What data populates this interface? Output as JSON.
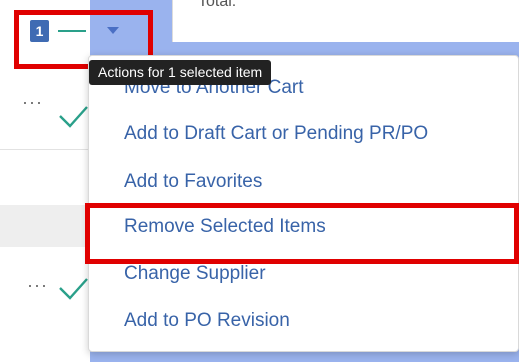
{
  "header": {
    "total_label": "Total:"
  },
  "selection": {
    "count": "1"
  },
  "tooltip": {
    "text": "Actions for 1 selected item"
  },
  "rows": [
    {
      "more": "···",
      "status_icon": "check-icon"
    },
    {
      "more": "···",
      "status_icon": "check-icon"
    }
  ],
  "menu": {
    "items": [
      {
        "label": "Move to Another Cart"
      },
      {
        "label": "Add to Draft Cart or Pending PR/PO"
      },
      {
        "label": "Add to Favorites"
      },
      {
        "label": "Remove Selected Items"
      },
      {
        "label": "Change Supplier"
      },
      {
        "label": "Add to PO Revision"
      }
    ]
  },
  "colors": {
    "accent": "#3863a8",
    "badge": "#3f6bb3",
    "check": "#2aa08a",
    "highlight": "#e00000",
    "tooltip_bg": "#222222"
  }
}
